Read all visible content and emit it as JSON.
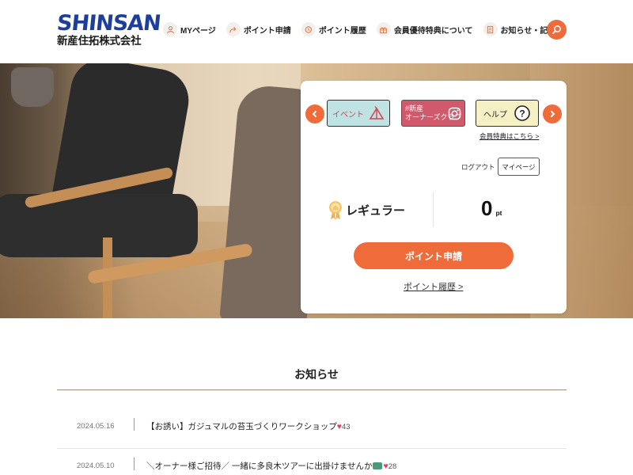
{
  "logo": {
    "en": "SHINSAN",
    "jp": "新産住拓株式会社"
  },
  "nav": {
    "items": [
      {
        "label": "MYページ",
        "icon": "user-icon"
      },
      {
        "label": "ポイント申請",
        "icon": "share-arrow-icon"
      },
      {
        "label": "ポイント履歴",
        "icon": "history-icon"
      },
      {
        "label": "会員優待特典について",
        "icon": "gift-icon"
      },
      {
        "label": "お知らせ・記事",
        "icon": "document-icon"
      }
    ],
    "search_icon": "search-icon"
  },
  "card": {
    "banners": [
      {
        "label": "イベント",
        "icon": "tent-icon"
      },
      {
        "line1": "#新産",
        "line2": "オーナーズクラブ",
        "icon": "instagram-icon"
      },
      {
        "label": "ヘルプ",
        "icon": "question-icon"
      }
    ],
    "benefits_link": "会員特典はこちら >",
    "logout": "ログアウト",
    "mypage_button": "マイページ",
    "rank": "レギュラー",
    "points_value": "0",
    "points_unit": "pt",
    "apply_button": "ポイント申請",
    "history_link": "ポイント履歴 >"
  },
  "news": {
    "title": "お知らせ",
    "items": [
      {
        "date": "2024.05.16",
        "text": "【お誘い】ガジュマルの苔玉づくりワークショップ",
        "likes": "43"
      },
      {
        "date": "2024.05.10",
        "text": "＼オーナー様ご招待／ 一緒に多良木ツアーに出掛けませんか",
        "likes": "28"
      }
    ]
  },
  "colors": {
    "accent": "#ef6b3a",
    "brand": "#1d3f9b"
  }
}
